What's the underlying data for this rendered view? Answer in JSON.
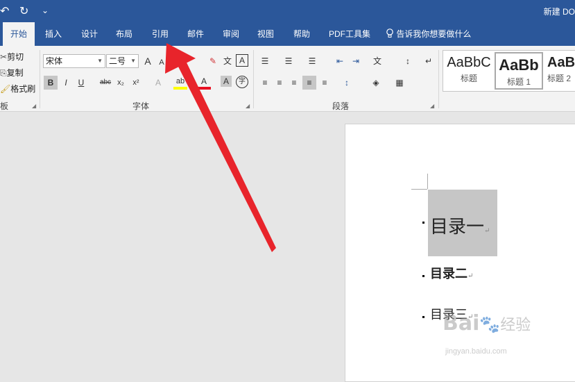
{
  "quick_access": {
    "undo_icon": "↶",
    "redo_icon": "↻",
    "customize_icon": "⌄"
  },
  "document_title": "新建 DO",
  "tabs": [
    "开始",
    "插入",
    "设计",
    "布局",
    "引用",
    "邮件",
    "审阅",
    "视图",
    "帮助",
    "PDF工具集"
  ],
  "active_tab": "开始",
  "tell_me": {
    "icon": "lightbulb-icon",
    "text": "告诉我你想要做什么"
  },
  "clipboard": {
    "cut_label": "剪切",
    "copy_label": "复制",
    "format_painter_label": "格式刷",
    "group_label_fragment": "板"
  },
  "font": {
    "font_name": "宋体",
    "font_size": "二号",
    "group_label": "字体",
    "buttons": {
      "grow": "A",
      "shrink": "A",
      "clear": "✎",
      "phonetic": "文",
      "border_char": "A",
      "bold": "B",
      "italic": "I",
      "underline": "U",
      "strikethrough": "abc",
      "subscript": "x₂",
      "superscript": "x²",
      "text_effects": "A",
      "highlight": "ab",
      "font_color": "A",
      "shading": "A",
      "enclose": "字"
    }
  },
  "paragraph": {
    "group_label": "段落",
    "buttons": {
      "bullets": "☰",
      "numbering": "☰",
      "multilevel": "☰",
      "decrease_indent": "⇤",
      "increase_indent": "⇥",
      "chinese_layout": "文",
      "sort": "↕",
      "show_marks": "↵",
      "align_left": "≡",
      "align_center": "≡",
      "align_right": "≡",
      "justify": "≡",
      "distributed": "≡",
      "line_spacing": "↕",
      "shading": "◈",
      "borders": "▦"
    }
  },
  "styles": [
    {
      "sample": "AaBbC",
      "name": "标题"
    },
    {
      "sample": "AaBb",
      "name": "标题 1"
    },
    {
      "sample": "AaB",
      "name": "标题 2"
    }
  ],
  "document": {
    "lines": [
      "目录一",
      "目录二",
      "目录三"
    ],
    "paragraph_mark": "↵"
  },
  "watermark": {
    "logo": "Bai",
    "brand": "经验",
    "url": "jingyan.baidu.com"
  },
  "colors": {
    "accent": "#2b579a",
    "ribbon_bg": "#f3f3f3",
    "arrow": "#e8242b",
    "highlight_yellow": "#ffff00",
    "font_red": "#e81123",
    "selection": "#c6c6c6"
  }
}
